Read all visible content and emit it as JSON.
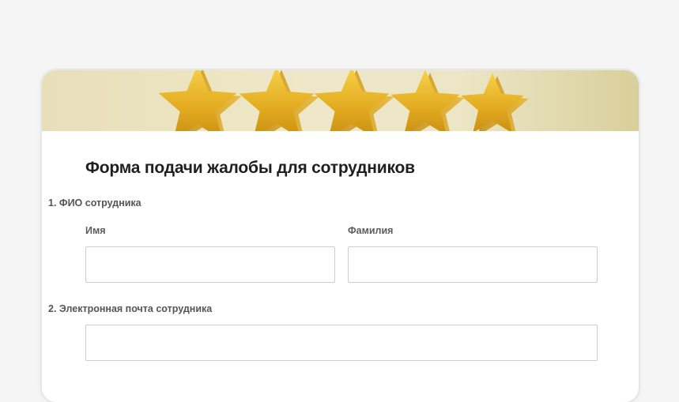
{
  "form": {
    "title": "Форма подачи жалобы для сотрудников",
    "questions": [
      {
        "number_label": "1. ФИО сотрудника",
        "fields": [
          {
            "label": "Имя",
            "value": "",
            "placeholder": ""
          },
          {
            "label": "Фамилия",
            "value": "",
            "placeholder": ""
          }
        ]
      },
      {
        "number_label": "2. Электронная почта сотрудника",
        "fields": [
          {
            "label": "",
            "value": "",
            "placeholder": ""
          }
        ]
      }
    ]
  },
  "banner": {
    "image": "five-gold-stars",
    "star_count": 5,
    "star_color": "#e8b427"
  }
}
